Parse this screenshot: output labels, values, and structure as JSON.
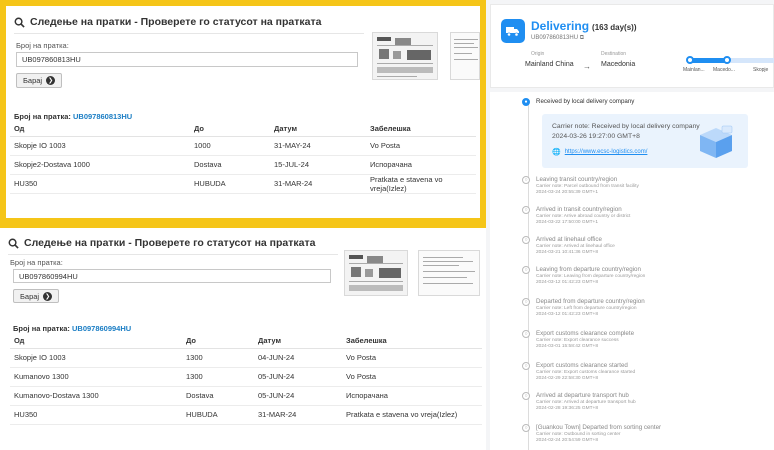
{
  "panels": [
    {
      "title": "Следење на пратки - Проверете го статусот на пратката",
      "field_label": "Број на пратка:",
      "input_value": "UB097860813HU",
      "button_label": "Барај",
      "number_prefix": "Број на пратка:",
      "number": "UB097860813HU",
      "columns": [
        "Од",
        "До",
        "Датум",
        "Забелешка"
      ],
      "rows": [
        [
          "Skopje IO 1003",
          "1000",
          "31-MAY-24",
          "Vo Posta"
        ],
        [
          "Skopje2-Dostava 1000",
          "Dostava",
          "15-JUL-24",
          "Испорачана"
        ],
        [
          "HU350",
          "HUBUDA",
          "31-MAR-24",
          "Pratkata e stavena vo vreja(Izlez)"
        ]
      ]
    },
    {
      "title": "Следење на пратки - Проверете го статусот на пратката",
      "field_label": "Број на пратка:",
      "input_value": "UB097860994HU",
      "button_label": "Барај",
      "number_prefix": "Број на пратка:",
      "number": "UB097860994HU",
      "columns": [
        "Од",
        "До",
        "Датум",
        "Забелешка"
      ],
      "rows": [
        [
          "Skopje IO 1003",
          "1300",
          "04-JUN-24",
          "Vo Posta"
        ],
        [
          "Kumanovo 1300",
          "1300",
          "05-JUN-24",
          "Vo Posta"
        ],
        [
          "Kumanovo-Dostava 1300",
          "Dostava",
          "05-JUN-24",
          "Испорачана"
        ],
        [
          "HU350",
          "HUBUDA",
          "31-MAR-24",
          "Pratkata e stavena vo vreja(Izlez)"
        ]
      ]
    }
  ],
  "tracker": {
    "status": "Delivering",
    "days": "(163 day(s))",
    "tracking_number": "UB097860813HU",
    "origin_label": "Origin",
    "origin": "Mainland China",
    "destination_label": "Destination",
    "destination": "Macedonia",
    "progress_labels": [
      "Mainlan...",
      "Macedo...",
      "Skopje"
    ],
    "progress_fraction": 0.45,
    "detail": {
      "note": "Carrier note: Received by local delivery company",
      "date": "2024-03-26 19:27:00 GMT+8",
      "link": "https://www.ecsc-logistics.com/"
    },
    "events": [
      {
        "title": "Received by local delivery company",
        "note": "",
        "date": ""
      },
      {
        "title": "Leaving transit country/region",
        "note": "Carrier note: Parcel outbound from transit facility",
        "date": "2024-03-24 20:55:39 GMT+1"
      },
      {
        "title": "Arrived in transit country/region",
        "note": "Carrier note: Arrive abroad country or district",
        "date": "2024-03-22 17:50:00 GMT+1"
      },
      {
        "title": "Arrived at linehaul office",
        "note": "Carrier note: Arrived at linehaul office",
        "date": "2024-03-21 10:41:36 GMT+8"
      },
      {
        "title": "Leaving from departure country/region",
        "note": "Carrier note: Leaving from departure country/region",
        "date": "2024-03-12 01:42:23 GMT+8"
      },
      {
        "title": "Departed from departure country/region",
        "note": "Carrier note: Left from departure country/region",
        "date": "2024-03-12 01:42:23 GMT+8"
      },
      {
        "title": "Export customs clearance complete",
        "note": "Carrier note: Export clearance success",
        "date": "2024-03-01 15:58:42 GMT+8"
      },
      {
        "title": "Export customs clearance started",
        "note": "Carrier note: Export customs clearance started",
        "date": "2024-02-29 22:58:30 GMT+8"
      },
      {
        "title": "Arrived at departure transport hub",
        "note": "Carrier note: Arrived at departure transport hub",
        "date": "2024-02-28 19:36:25 GMT+8"
      },
      {
        "title": "[Guankou Town] Departed from sorting center",
        "note": "Carrier note: Outbound in sorting center",
        "date": "2024-02-24 20:54:59 GMT+8"
      }
    ]
  }
}
